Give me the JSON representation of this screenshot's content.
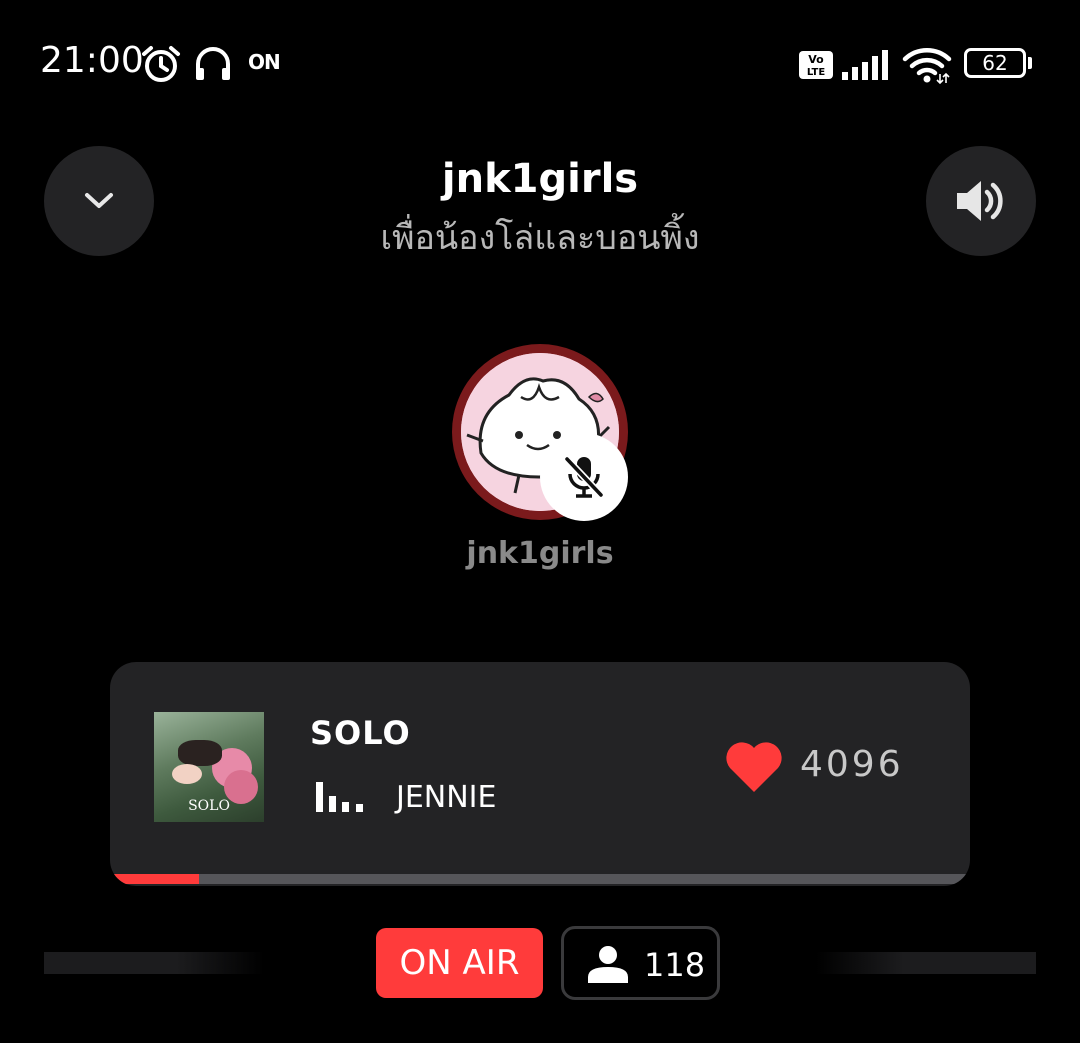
{
  "status_bar": {
    "time": "21:00",
    "on_label": "ON",
    "volte_label": "Vo LTE",
    "battery": "62",
    "icons": [
      "alarm-icon",
      "headphones-icon",
      "signal-icon",
      "wifi-icon",
      "battery-icon"
    ]
  },
  "header": {
    "title": "jnk1girls",
    "subtitle": "เพื่อน้องโล่และบอนพิ้ง",
    "left_button_icon": "chevron-down-icon",
    "right_button_icon": "speaker-icon"
  },
  "host": {
    "name": "jnk1girls",
    "mic_status_icon": "mic-muted-icon"
  },
  "now_playing": {
    "title": "SOLO",
    "artist": "JENNIE",
    "cover_text": "SOLO",
    "likes": "4096",
    "progress_fraction": 0.1,
    "accent_color": "#ff3b3b"
  },
  "footer": {
    "on_air_label": "ON AIR",
    "listener_count": "118"
  },
  "colors": {
    "background": "#000000",
    "surface": "#232325",
    "accent": "#ff3b3b",
    "avatar_ring": "#7b1a1c",
    "muted_text": "#8a8a8a"
  }
}
